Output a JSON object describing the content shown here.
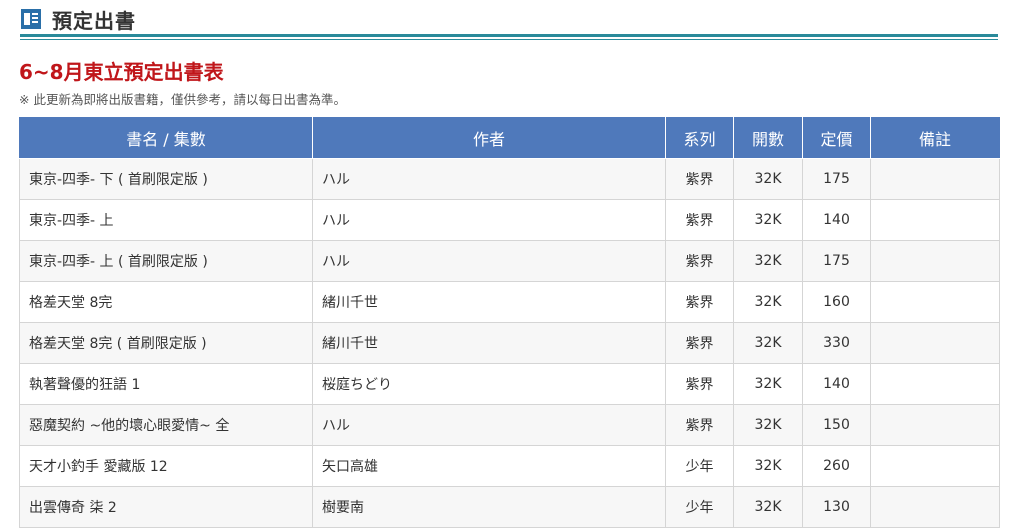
{
  "header": {
    "title": "預定出書",
    "icon": "newspaper-icon",
    "accent_color": "#2a8a9a"
  },
  "list": {
    "title": "6~8月東立預定出書表",
    "title_color": "#c0161a",
    "note": "※ 此更新為即將出版書籍，僅供參考，請以每日出書為準。"
  },
  "table": {
    "header_color": "#4f79bb",
    "columns": [
      "書名 / 集數",
      "作者",
      "系列",
      "開數",
      "定價",
      "備註"
    ],
    "rows": [
      {
        "title": "東京-四季- 下 ( 首刷限定版 )",
        "author": "ハル",
        "series": "紫界",
        "format": "32K",
        "price": "175",
        "remark": ""
      },
      {
        "title": "東京-四季- 上",
        "author": "ハル",
        "series": "紫界",
        "format": "32K",
        "price": "140",
        "remark": ""
      },
      {
        "title": "東京-四季- 上 ( 首刷限定版 )",
        "author": "ハル",
        "series": "紫界",
        "format": "32K",
        "price": "175",
        "remark": ""
      },
      {
        "title": "格差天堂 8完",
        "author": "緒川千世",
        "series": "紫界",
        "format": "32K",
        "price": "160",
        "remark": ""
      },
      {
        "title": "格差天堂 8完 ( 首刷限定版 )",
        "author": "緒川千世",
        "series": "紫界",
        "format": "32K",
        "price": "330",
        "remark": ""
      },
      {
        "title": "執著聲優的狂語 1",
        "author": "桜庭ちどり",
        "series": "紫界",
        "format": "32K",
        "price": "140",
        "remark": ""
      },
      {
        "title": "惡魔契約 ~他的壞心眼愛情~ 全",
        "author": "ハル",
        "series": "紫界",
        "format": "32K",
        "price": "150",
        "remark": ""
      },
      {
        "title": "天才小釣手 愛藏版 12",
        "author": "矢口高雄",
        "series": "少年",
        "format": "32K",
        "price": "260",
        "remark": ""
      },
      {
        "title": "出雲傳奇 柒 2",
        "author": "樹要南",
        "series": "少年",
        "format": "32K",
        "price": "130",
        "remark": ""
      }
    ]
  }
}
